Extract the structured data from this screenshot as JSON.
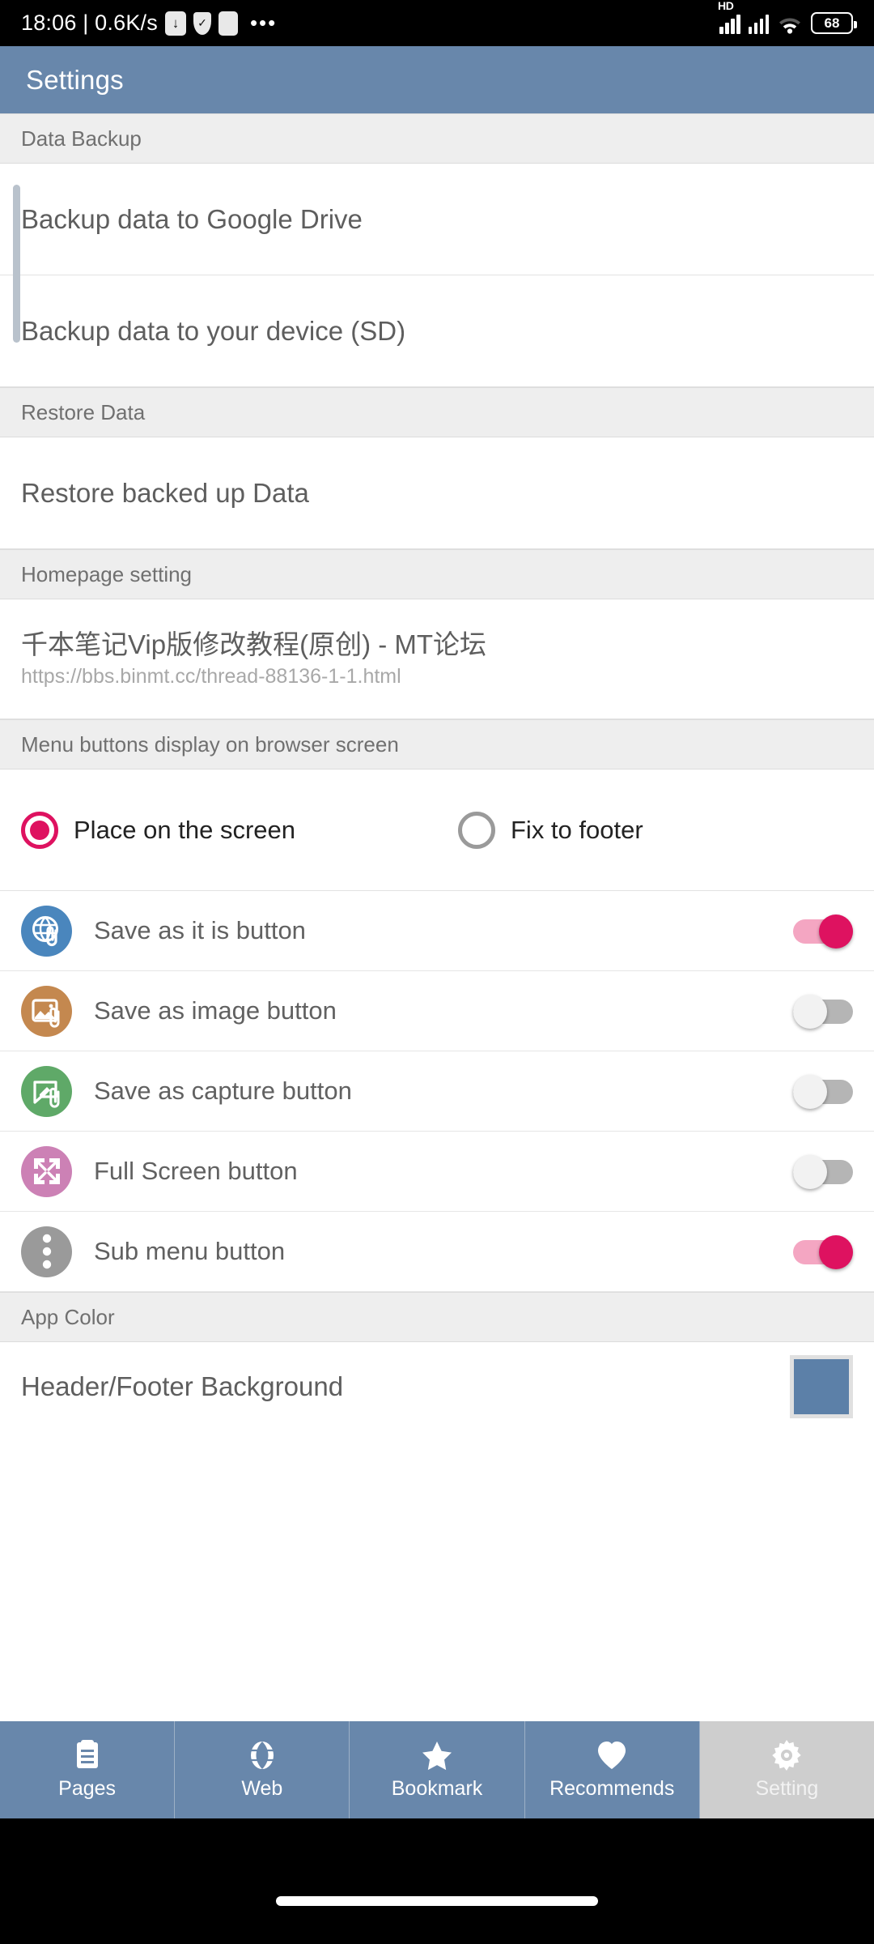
{
  "status_bar": {
    "time": "18:06 | 0.6K/s",
    "icons": [
      "download-icon",
      "shield-icon",
      "blank-notification-icon",
      "overflow-dots-icon"
    ],
    "network_label": "HD",
    "battery_percent": "68",
    "signal_icon": "signal-bars-icon",
    "wifi_icon": "wifi-icon",
    "battery_icon": "battery-icon"
  },
  "app_bar": {
    "title": "Settings"
  },
  "sections": {
    "data_backup": {
      "header": "Data Backup",
      "items": [
        {
          "label": "Backup data to Google Drive"
        },
        {
          "label": "Backup data to your device (SD)"
        }
      ]
    },
    "restore_data": {
      "header": "Restore Data",
      "items": [
        {
          "label": "Restore backed up Data"
        }
      ]
    },
    "homepage_setting": {
      "header": "Homepage setting",
      "title": "千本笔记Vip版修改教程(原创) - MT论坛",
      "url": "https://bbs.binmt.cc/thread-88136-1-1.html"
    },
    "menu_buttons": {
      "header": "Menu buttons display on browser screen",
      "options": [
        {
          "label": "Place on the screen",
          "selected": true
        },
        {
          "label": "Fix to footer",
          "selected": false
        }
      ],
      "toggles": [
        {
          "label": "Save as it is button",
          "icon": "globe-attach-icon",
          "icon_color": "#4a86bd",
          "on": true
        },
        {
          "label": "Save as image button",
          "icon": "image-attach-icon",
          "icon_color": "#c4884f",
          "on": false
        },
        {
          "label": "Save as capture button",
          "icon": "capture-attach-icon",
          "icon_color": "#5fa968",
          "on": false
        },
        {
          "label": "Full Screen button",
          "icon": "fullscreen-icon",
          "icon_color": "#cc81b5",
          "on": false
        },
        {
          "label": "Sub menu button",
          "icon": "kebab-menu-icon",
          "icon_color": "#9a9a9a",
          "on": true
        }
      ]
    },
    "app_color": {
      "header": "App Color",
      "items": [
        {
          "label": "Header/Footer Background",
          "color": "#5c80a8"
        }
      ]
    }
  },
  "bottom_nav": {
    "items": [
      {
        "label": "Pages",
        "icon": "document-icon",
        "active": false
      },
      {
        "label": "Web",
        "icon": "globe-icon",
        "active": false
      },
      {
        "label": "Bookmark",
        "icon": "star-icon",
        "active": false
      },
      {
        "label": "Recommends",
        "icon": "heart-icon",
        "active": false
      },
      {
        "label": "Setting",
        "icon": "gear-icon",
        "active": true
      }
    ]
  },
  "theme": {
    "accent": "#de1260",
    "header_bg": "#6887ab",
    "section_bg": "#eeeeee"
  }
}
